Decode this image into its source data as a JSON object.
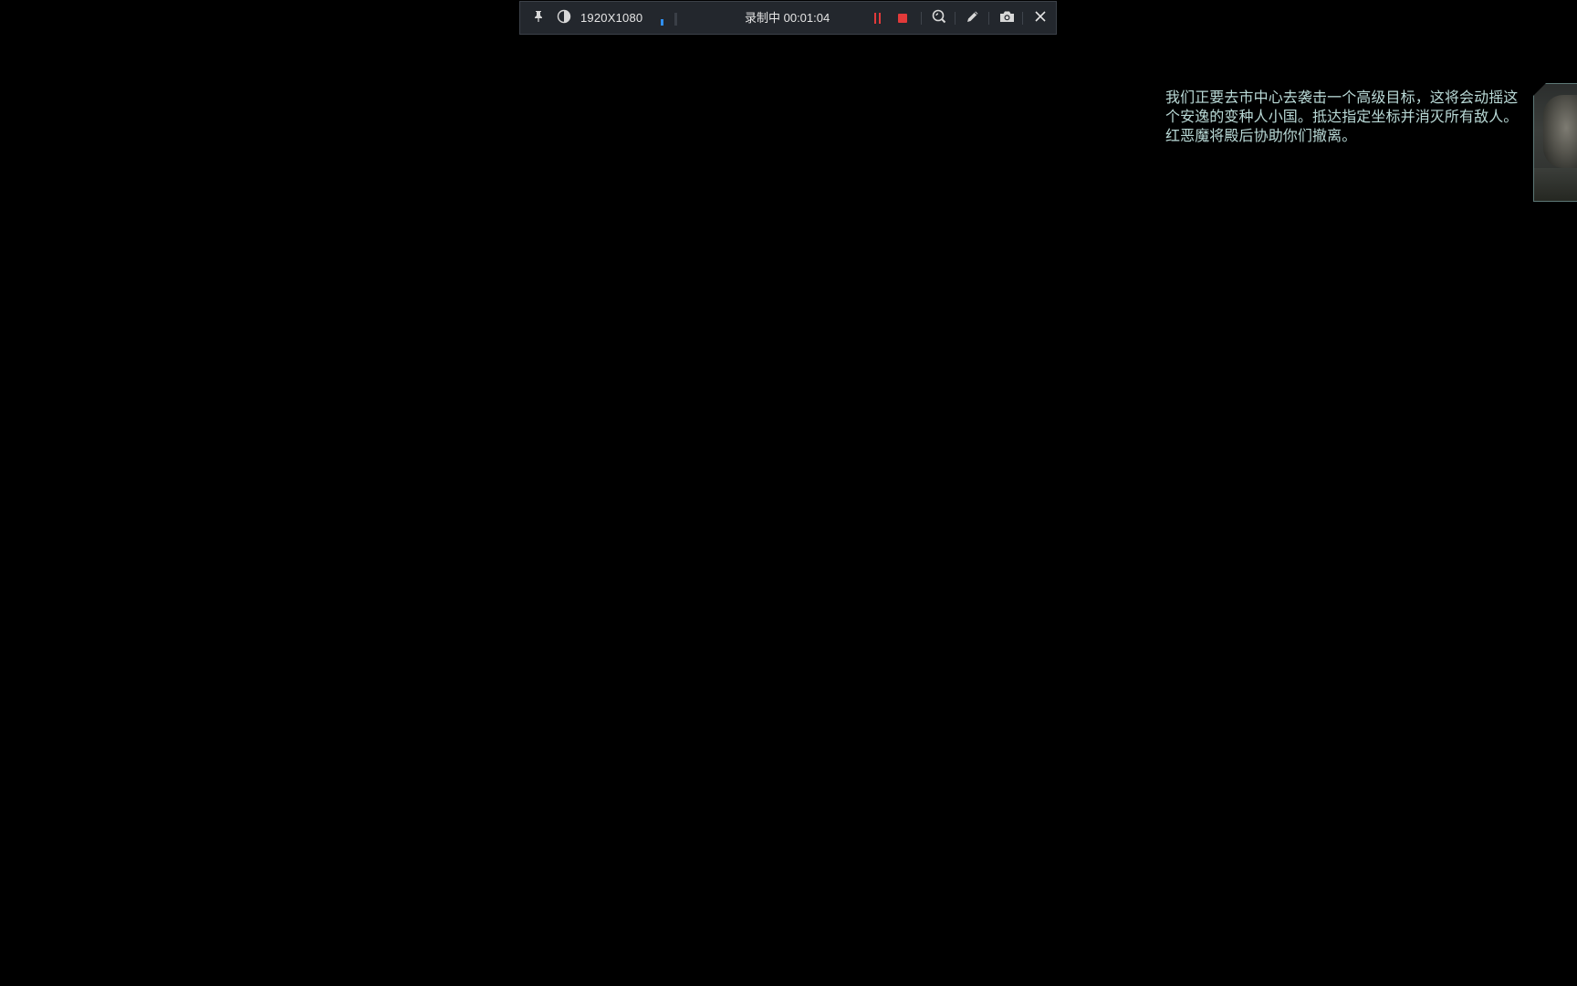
{
  "recorder": {
    "resolution": "1920X1080",
    "status": "录制中 00:01:04",
    "level_bars": 2,
    "level_active": 1,
    "colors": {
      "background": "#23272d",
      "record_accent": "#e23a3a",
      "level_accent": "#2f8ff0"
    },
    "icons": [
      "pin-icon",
      "contrast-icon",
      "pause-icon",
      "stop-icon",
      "zoom-icon",
      "pen-icon",
      "camera-icon",
      "close-icon"
    ]
  },
  "briefing": {
    "text": "我们正要去市中心去袭击一个高级目标，这将会动摇这个安逸的变种人小国。抵达指定坐标并消灭所有敌人。红恶魔将殿后协助你们撤离。",
    "color": "#b9d9d6"
  }
}
